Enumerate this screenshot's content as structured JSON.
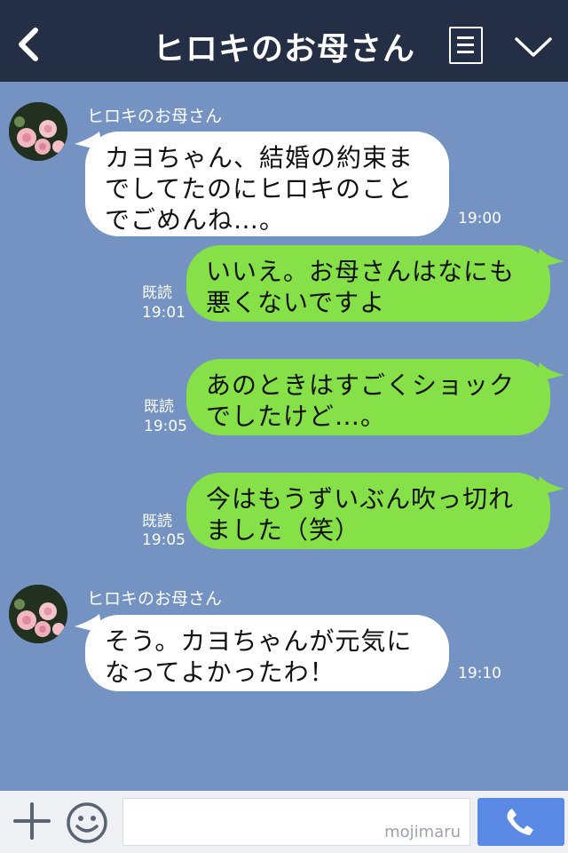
{
  "header": {
    "title": "ヒロキのお母さん",
    "back_icon": "chevron-left-icon",
    "menu_icon": "menu-list-icon",
    "collapse_icon": "chevron-down-icon"
  },
  "messages": [
    {
      "direction": "incoming",
      "sender": "ヒロキのお母さん",
      "lines": [
        "カヨちゃん、結婚の約束ま",
        "でしてたのにヒロキのこと",
        "でごめんね…。"
      ],
      "time": "19:00"
    },
    {
      "direction": "outgoing",
      "lines": [
        "いいえ。お母さんはなにも",
        "悪くないですよ"
      ],
      "read": "既読",
      "time": "19:01"
    },
    {
      "direction": "outgoing",
      "lines": [
        "あのときはすごくショック",
        "でしたけど…。"
      ],
      "read": "既読",
      "time": "19:05"
    },
    {
      "direction": "outgoing",
      "lines": [
        "今はもうずいぶん吹っ切れ",
        "ました（笑）"
      ],
      "read": "既読",
      "time": "19:05"
    },
    {
      "direction": "incoming",
      "sender": "ヒロキのお母さん",
      "lines": [
        "そう。カヨちゃんが元気に",
        "なってよかったわ！"
      ],
      "time": "19:10"
    }
  ],
  "footer": {
    "plus_icon": "plus-icon",
    "emoji_icon": "smiley-icon",
    "input_value": "",
    "watermark": "mojimaru",
    "send_icon": "phone-icon"
  },
  "colors": {
    "header_bg": "#242e45",
    "chat_bg": "#7493c2",
    "outgoing_bubble": "#86e048",
    "incoming_bubble": "#ffffff",
    "send_button": "#5a8ae6"
  }
}
